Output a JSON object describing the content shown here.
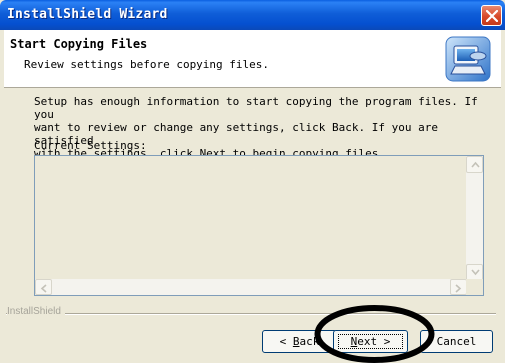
{
  "window": {
    "title": "InstallShield Wizard"
  },
  "header": {
    "title": "Start Copying Files",
    "subtitle": "Review settings before copying files.",
    "icon": "computer-setup-icon"
  },
  "body": {
    "description": "Setup has enough information to start copying the program files.  If you\nwant to review or change any settings, click Back.  If you are satisfied\nwith the settings, click Next to begin copying files.",
    "current_settings_label": "Current Settings:",
    "current_settings_value": ""
  },
  "footer": {
    "brand": "InstallShield",
    "back_label_prefix": "< ",
    "back_label_mnemonic": "B",
    "back_label_rest": "ack",
    "next_label_mnemonic": "N",
    "next_label_rest": "ext >",
    "cancel_label": "Cancel"
  },
  "colors": {
    "titlebar": "#0550d0",
    "close_button": "#d8492a",
    "annotation": "#000000"
  }
}
